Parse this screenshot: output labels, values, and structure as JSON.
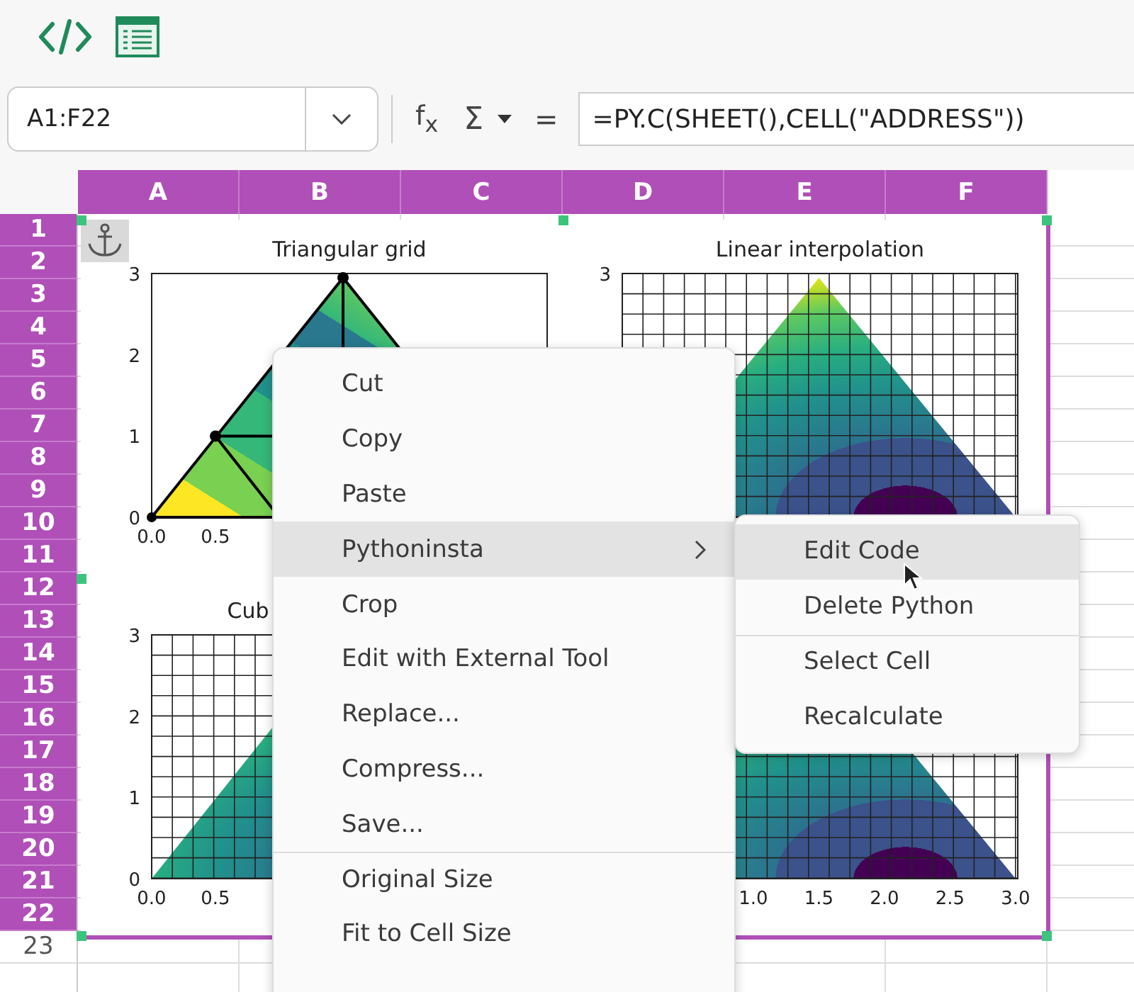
{
  "formula_bar": {
    "name_box": "A1:F22",
    "function_button": "f$_{x}$",
    "sum_button": "Σ",
    "equals_button": "=",
    "formula": "=PY.C(SHEET(),CELL(\"ADDRESS\"))"
  },
  "sheet": {
    "columns": [
      {
        "label": "A",
        "selected": true
      },
      {
        "label": "B",
        "selected": true
      },
      {
        "label": "C",
        "selected": true
      },
      {
        "label": "D",
        "selected": true
      },
      {
        "label": "E",
        "selected": true
      },
      {
        "label": "F",
        "selected": true
      }
    ],
    "rows": [
      {
        "label": "1",
        "selected": true
      },
      {
        "label": "2",
        "selected": true
      },
      {
        "label": "3",
        "selected": true
      },
      {
        "label": "4",
        "selected": true
      },
      {
        "label": "5",
        "selected": true
      },
      {
        "label": "6",
        "selected": true
      },
      {
        "label": "7",
        "selected": true
      },
      {
        "label": "8",
        "selected": true
      },
      {
        "label": "9",
        "selected": true
      },
      {
        "label": "10",
        "selected": true
      },
      {
        "label": "11",
        "selected": true
      },
      {
        "label": "12",
        "selected": true
      },
      {
        "label": "13",
        "selected": true
      },
      {
        "label": "14",
        "selected": true
      },
      {
        "label": "15",
        "selected": true
      },
      {
        "label": "16",
        "selected": true
      },
      {
        "label": "17",
        "selected": true
      },
      {
        "label": "18",
        "selected": true
      },
      {
        "label": "19",
        "selected": true
      },
      {
        "label": "20",
        "selected": true
      },
      {
        "label": "21",
        "selected": true
      },
      {
        "label": "22",
        "selected": true
      },
      {
        "label": "23",
        "selected": false
      }
    ]
  },
  "image": {
    "plots": [
      {
        "kind": "mesh",
        "title": "Triangular grid",
        "yticks": [
          "3",
          "2",
          "1",
          "0"
        ],
        "xticks": [
          "0.0",
          "0.5"
        ]
      },
      {
        "kind": "contour",
        "title": "Linear interpolation",
        "yticks": [
          "3"
        ]
      },
      {
        "kind": "contour",
        "title": "Cub",
        "yticks": [
          "3",
          "2",
          "1",
          "0"
        ],
        "xticks": [
          "0.0",
          "0.5"
        ]
      },
      {
        "kind": "contour",
        "xticks": [
          "1.0",
          "1.5",
          "2.0",
          "2.5",
          "3.0"
        ]
      }
    ]
  },
  "context_menu": {
    "items": [
      {
        "label": "Cut",
        "selected": false,
        "submenu": false,
        "separator_before": false
      },
      {
        "label": "Copy",
        "selected": false,
        "submenu": false,
        "separator_before": false
      },
      {
        "label": "Paste",
        "selected": false,
        "submenu": false,
        "separator_before": false
      },
      {
        "label": "Pythoninsta",
        "selected": true,
        "submenu": true,
        "separator_before": false
      },
      {
        "label": "Crop",
        "selected": false,
        "submenu": false,
        "separator_before": false
      },
      {
        "label": "Edit with External Tool",
        "selected": false,
        "submenu": false,
        "separator_before": false
      },
      {
        "label": "Replace...",
        "selected": false,
        "submenu": false,
        "separator_before": false
      },
      {
        "label": "Compress...",
        "selected": false,
        "submenu": false,
        "separator_before": false
      },
      {
        "label": "Save...",
        "selected": false,
        "submenu": false,
        "separator_before": false
      },
      {
        "label": "Original Size",
        "selected": false,
        "submenu": false,
        "separator_before": true
      },
      {
        "label": "Fit to Cell Size",
        "selected": false,
        "submenu": false,
        "separator_before": false
      }
    ]
  },
  "submenu": {
    "items": [
      {
        "label": "Edit Code",
        "selected": true,
        "separator_before": false
      },
      {
        "label": "Delete Python",
        "selected": false,
        "separator_before": false
      },
      {
        "label": "Select Cell",
        "selected": false,
        "separator_before": true
      },
      {
        "label": "Recalculate",
        "selected": false,
        "separator_before": false
      }
    ]
  }
}
